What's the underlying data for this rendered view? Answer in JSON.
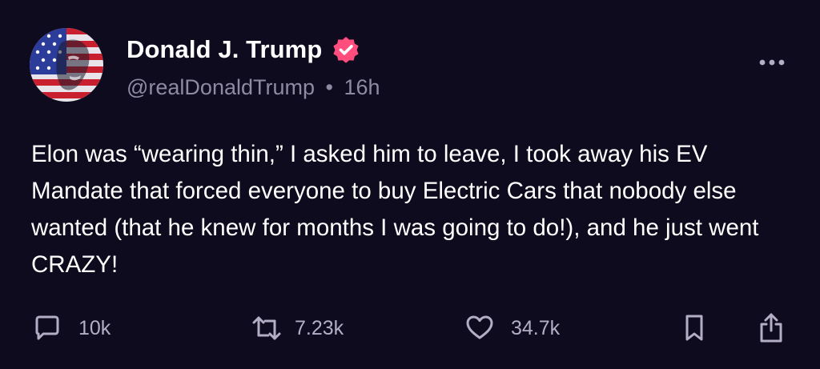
{
  "author": {
    "name": "Donald J. Trump",
    "handle": "@realDonaldTrump",
    "separator": "•",
    "time": "16h",
    "verified_color": "#ff4d7d"
  },
  "post": {
    "text": "Elon was “wearing thin,” I asked him to leave, I took away his EV Mandate that forced everyone to buy Electric Cars that nobody else wanted (that he knew for months I was going to do!), and he just went CRAZY!"
  },
  "actions": {
    "replies": "10k",
    "reposts": "7.23k",
    "likes": "34.7k"
  },
  "icons": {
    "avatar": "avatar-flag-portrait",
    "verified": "verified-badge-icon",
    "more": "more-options-icon",
    "reply": "reply-icon",
    "repost": "repost-icon",
    "like": "heart-icon",
    "bookmark": "bookmark-icon",
    "share": "share-icon"
  },
  "colors": {
    "background": "#0f0b1e",
    "text": "#ffffff",
    "muted": "#8f8aa3",
    "icon": "#b3adc6"
  }
}
